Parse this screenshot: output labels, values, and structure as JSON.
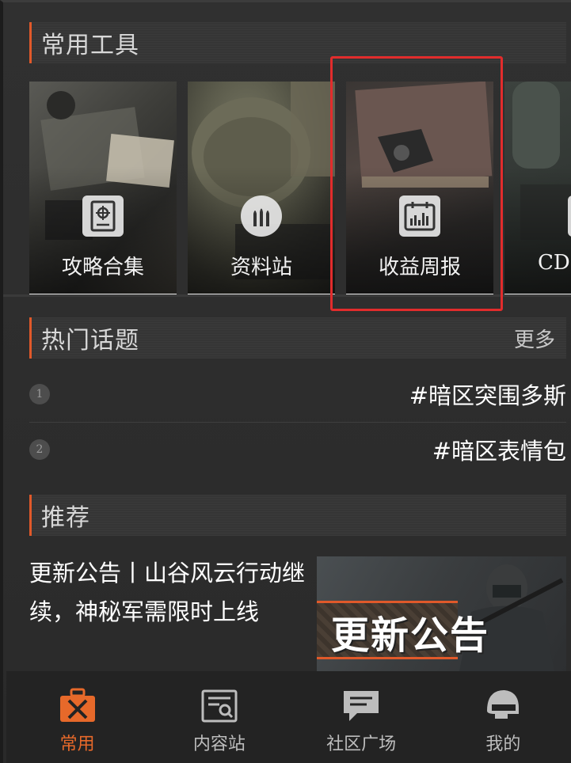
{
  "tools_section": {
    "title": "常用工具",
    "items": [
      {
        "label": "攻略合集",
        "icon": "document-target-icon"
      },
      {
        "label": "资料站",
        "icon": "bullets-icon"
      },
      {
        "label": "收益周报",
        "icon": "calendar-chart-icon"
      },
      {
        "label": "CDK",
        "icon": "gift-box-icon"
      }
    ]
  },
  "topics_section": {
    "title": "热门话题",
    "more_label": "更多",
    "items": [
      {
        "rank": "1",
        "text": "#暗区突围多斯"
      },
      {
        "rank": "2",
        "text": "#暗区表情包"
      }
    ]
  },
  "recommend_section": {
    "title": "推荐",
    "article": {
      "title": "更新公告丨山谷风云行动继续，神秘军需限时上线",
      "thumbnail_text": "更新公告"
    }
  },
  "bottom_nav": {
    "items": [
      {
        "label": "常用",
        "icon": "toolbox-icon",
        "active": true
      },
      {
        "label": "内容站",
        "icon": "content-search-icon",
        "active": false
      },
      {
        "label": "社区广场",
        "icon": "chat-bubble-icon",
        "active": false
      },
      {
        "label": "我的",
        "icon": "helmet-icon",
        "active": false
      }
    ]
  },
  "colors": {
    "accent": "#e0592a",
    "active_nav": "#e7692a",
    "highlight_box": "#e22c2c",
    "background": "#2b2b2b"
  }
}
